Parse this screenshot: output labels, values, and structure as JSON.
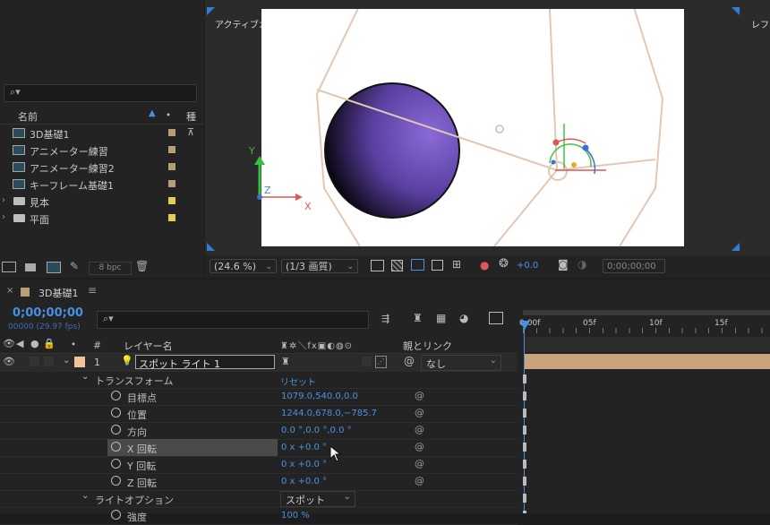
{
  "project": {
    "columns": {
      "name": "名前",
      "type": "種"
    },
    "items": [
      {
        "kind": "comp",
        "label": "3D基礎1",
        "tag_color": "#b59e78"
      },
      {
        "kind": "comp",
        "label": "アニメーター練習",
        "tag_color": "#b59e78"
      },
      {
        "kind": "comp",
        "label": "アニメーター練習2",
        "tag_color": "#b59e78"
      },
      {
        "kind": "comp",
        "label": "キーフレーム基礎1",
        "tag_color": "#b59e78"
      },
      {
        "kind": "folder",
        "label": "見本",
        "tag_color": "#e0d05a"
      },
      {
        "kind": "folder",
        "label": "平面",
        "tag_color": "#e0d05a"
      }
    ],
    "bpc": "8 bpc"
  },
  "viewer": {
    "left_view_label": "アクティブカメラ ( デフォルト )",
    "right_view_label": "レフト",
    "axis_y": "Y",
    "axis_z": "Z",
    "axis_x": "X",
    "zoom": "(24.6 %)",
    "resolution": "(1/3 画質)",
    "exposure": "+0.0",
    "timecode": "0;00;00;00"
  },
  "timeline": {
    "tab_label": "3D基礎1",
    "timecode": "0;00;00;00",
    "frame_info": "00000 (29.97 fps)",
    "col_num": "#",
    "col_layer_name": "レイヤー名",
    "col_parent": "親とリンク",
    "ruler": [
      "0:00f",
      "05f",
      "10f",
      "15f"
    ],
    "layer": {
      "number": "1",
      "name": "スポット ライト 1",
      "parent": "なし"
    },
    "transform": {
      "label": "トランスフォーム",
      "reset": "リセット"
    },
    "properties": [
      {
        "label": "目標点",
        "value": "1079.0,540.0,0.0"
      },
      {
        "label": "位置",
        "value": "1244.0,678.0,−785.7"
      },
      {
        "label": "方向",
        "value": "0.0 °,0.0 °,0.0 °"
      },
      {
        "label": "X 回転",
        "value": "0 x +0.0 °"
      },
      {
        "label": "Y 回転",
        "value": "0 x +0.0 °"
      },
      {
        "label": "Z 回転",
        "value": "0 x +0.0 °"
      }
    ],
    "light_options": {
      "label": "ライトオプション",
      "value": "スポット"
    },
    "partial_row": {
      "label": "強度",
      "value": "100 %"
    }
  }
}
